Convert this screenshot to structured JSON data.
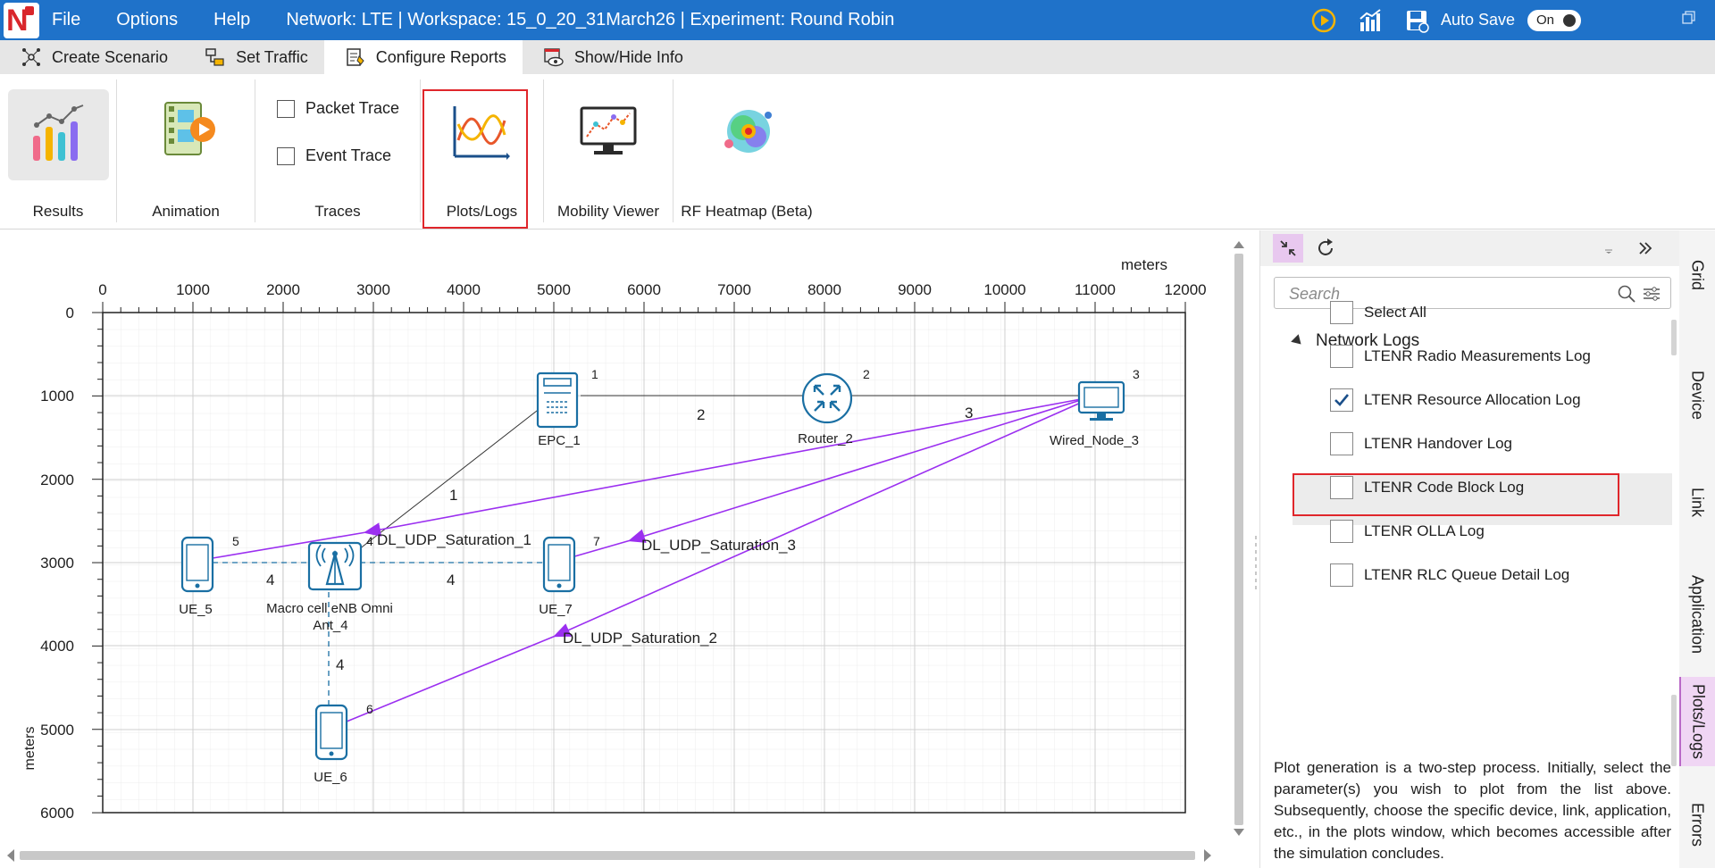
{
  "titlebar": {
    "menu": [
      "File",
      "Options",
      "Help"
    ],
    "title": "Network: LTE | Workspace: 15_0_20_31March26 | Experiment: Round Robin",
    "autosave_label": "Auto Save",
    "toggle_state": "On"
  },
  "tabs": [
    {
      "label": "Create Scenario",
      "icon": "scenario-icon"
    },
    {
      "label": "Set Traffic",
      "icon": "traffic-icon"
    },
    {
      "label": "Configure Reports",
      "icon": "reports-icon",
      "active": true
    },
    {
      "label": "Show/Hide Info",
      "icon": "eye-icon"
    }
  ],
  "ribbon": {
    "results": "Results",
    "animation": "Animation",
    "traces": "Traces",
    "packet_trace": "Packet Trace",
    "event_trace": "Event Trace",
    "plots_logs": "Plots/Logs",
    "mobility_viewer": "Mobility Viewer",
    "rf_heatmap": "RF Heatmap (Beta)"
  },
  "canvas": {
    "x_unit": "meters",
    "y_unit": "meters",
    "x_ticks": [
      "0",
      "1000",
      "2000",
      "3000",
      "4000",
      "5000",
      "6000",
      "7000",
      "8000",
      "9000",
      "10000",
      "11000",
      "12000"
    ],
    "y_ticks": [
      "0",
      "1000",
      "2000",
      "3000",
      "4000",
      "5000",
      "6000"
    ],
    "nodes": [
      {
        "id": "epc",
        "label": "EPC_1",
        "num": "1"
      },
      {
        "id": "router",
        "label": "Router_2",
        "num": "2"
      },
      {
        "id": "wired",
        "label": "Wired_Node_3",
        "num": "3"
      },
      {
        "id": "enb",
        "label_1": "Macro cell eNB Omni",
        "label_2": "Ant_4",
        "num": "4"
      },
      {
        "id": "ue5",
        "label": "UE_5",
        "num": "5"
      },
      {
        "id": "ue6",
        "label": "UE_6",
        "num": "6"
      },
      {
        "id": "ue7",
        "label": "UE_7",
        "num": "7"
      }
    ],
    "link_labels": [
      "1",
      "2",
      "3",
      "4",
      "4",
      "4"
    ],
    "flows": [
      "DL_UDP_Saturation_1",
      "DL_UDP_Saturation_2",
      "DL_UDP_Saturation_3"
    ]
  },
  "panel": {
    "search_placeholder": "Search",
    "section": "Network Logs",
    "items": [
      {
        "label": "Select All",
        "checked": false
      },
      {
        "label": "LTENR Radio Measurements Log",
        "checked": false
      },
      {
        "label": "LTENR Resource Allocation Log",
        "checked": true
      },
      {
        "label": "LTENR Handover Log",
        "checked": false
      },
      {
        "label": "LTENR Code Block Log",
        "checked": false
      },
      {
        "label": "LTENR OLLA Log",
        "checked": false
      },
      {
        "label": "LTENR RLC Queue Detail Log",
        "checked": false
      }
    ],
    "help": "Plot generation is a two-step process. Initially, select the parameter(s) you wish to plot from the list above. Subsequently, choose the specific device, link, application, etc., in the plots window, which becomes accessible after the simulation concludes."
  },
  "sidetabs": [
    "Grid",
    "Device",
    "Link",
    "Application",
    "Plots/Logs",
    "Errors"
  ],
  "colors": {
    "titlebar": "#1f72c9",
    "highlight": "#e0262b",
    "flow": "#9b2ff0",
    "device": "#1a6fa3",
    "active_side_tab": "#f0d6f4"
  }
}
